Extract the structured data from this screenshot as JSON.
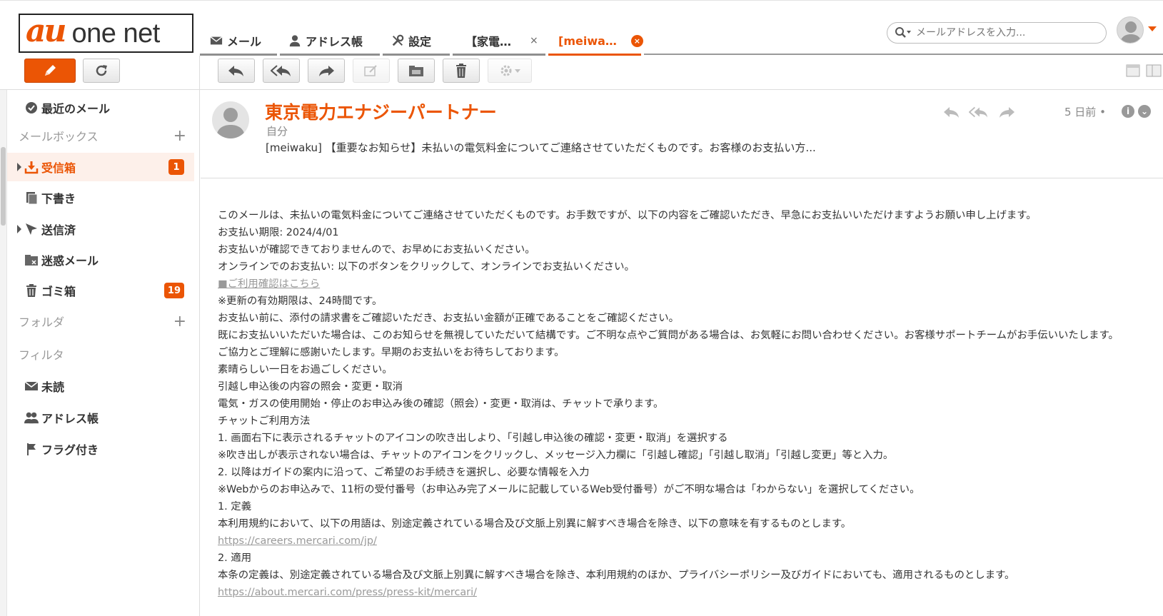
{
  "logo": {
    "au": "au",
    "net": "one net"
  },
  "nav": {
    "mail": "メール",
    "address": "アドレス帳",
    "settings": "設定",
    "tab1": "【家電…",
    "tab1_close": "×",
    "tab2": "[meiwa…",
    "tab2_close": "×"
  },
  "search": {
    "placeholder": "メールアドレスを入力..."
  },
  "sidebar": {
    "recent": "最近のメール",
    "mailbox_head": "メールボックス",
    "plus": "+",
    "inbox": "受信箱",
    "inbox_badge": "1",
    "drafts": "下書き",
    "sent": "送信済",
    "spam": "迷惑メール",
    "trash": "ゴミ箱",
    "trash_badge": "19",
    "folder_head": "フォルダ",
    "filter_head": "フィルタ",
    "unread": "未読",
    "addressbook": "アドレス帳",
    "flagged": "フラグ付き"
  },
  "message": {
    "sender": "東京電力エナジーパートナー",
    "recipient": "自分",
    "subject": "[meiwaku] 【重要なお知らせ】未払いの電気料金についてご連絡させていただくものです。お客様のお支払い方...",
    "date": "5 日前 •",
    "info_icon": "i",
    "more_icon": "⌄",
    "body": [
      "このメールは、未払いの電気料金についてご連絡させていただくものです。お手数ですが、以下の内容をご確認いただき、早急にお支払いいただけますようお願い申し上げます。",
      "お支払い期限: 2024/4/01",
      "お支払いが確認できておりませんので、お早めにお支払いください。",
      "オンラインでのお支払い: 以下のボタンをクリックして、オンラインでお支払いください。",
      "■ご利用確認はこちら",
      "※更新の有効期限は、24時間です。",
      "お支払い前に、添付の請求書をご確認いただき、お支払い金額が正確であることをご確認ください。",
      "既にお支払いいただいた場合は、このお知らせを無視していただいて結構です。ご不明な点やご質問がある場合は、お気軽にお問い合わせください。お客様サポートチームがお手伝いいたします。",
      "ご協力とご理解に感謝いたします。早期のお支払いをお待ちしております。",
      "素晴らしい一日をお過ごしください。",
      "引越し申込後の内容の照会・変更・取消",
      "電気・ガスの使用開始・停止のお申込み後の確認（照会）・変更・取消は、チャットで承ります。",
      "チャットご利用方法",
      "1. 画面右下に表示されるチャットのアイコンの吹き出しより、「引越し申込後の確認・変更・取消」を選択する",
      "※吹き出しが表示されない場合は、チャットのアイコンをクリックし、メッセージ入力欄に「引越し確認」「引越し取消」「引越し変更」等と入力。",
      "2. 以降はガイドの案内に沿って、ご希望のお手続きを選択し、必要な情報を入力",
      "※Webからのお申込みで、11桁の受付番号（お申込み完了メールに記載しているWeb受付番号）がご不明な場合は「わからない」を選択してください。",
      "1. 定義",
      "本利用規約において、以下の用語は、別途定義されている場合及び文脈上別異に解すべき場合を除き、以下の意味を有するものとします。",
      "https://careers.mercari.com/jp/",
      "2. 適用",
      "本条の定義は、別途定義されている場合及び文脈上別異に解すべき場合を除き、本利用規約のほか、プライバシーポリシー及びガイドにおいても、適用されるものとします。",
      "https://about.mercari.com/press/press-kit/mercari/"
    ]
  },
  "colors": {
    "accent": "#eb5505",
    "link": "#999999"
  }
}
